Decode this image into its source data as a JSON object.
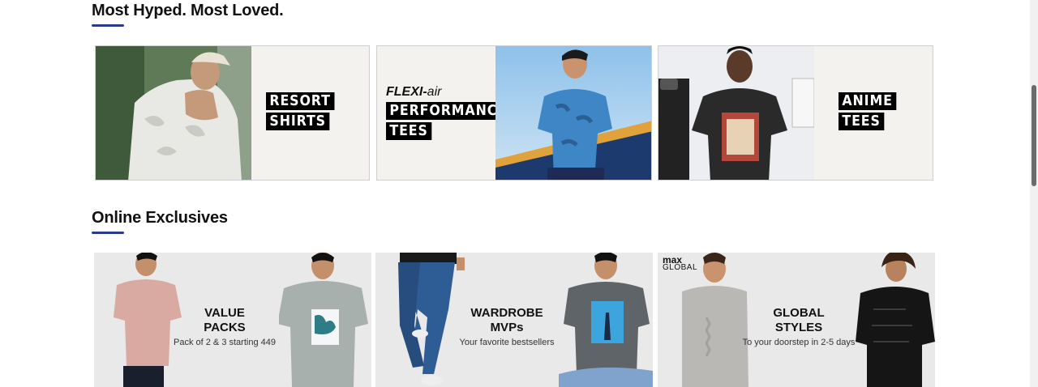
{
  "sections": {
    "hyped": {
      "title": "Most Hyped. Most Loved.",
      "cards": [
        {
          "lines": [
            "RESORT",
            "SHIRTS"
          ]
        },
        {
          "brand_bold": "FLEXI-",
          "brand_light": "air",
          "lines": [
            "PERFORMANCE",
            "TEES"
          ]
        },
        {
          "lines": [
            "ANIME",
            "TEES"
          ]
        }
      ]
    },
    "exclusives": {
      "title": "Online Exclusives",
      "cards": [
        {
          "heading1": "VALUE",
          "heading2": "PACKS",
          "sub": "Pack of 2 & 3 starting 449"
        },
        {
          "heading1": "WARDROBE",
          "heading2": "MVPs",
          "sub": "Your favorite bestsellers"
        },
        {
          "logo_top": "max",
          "logo_bottom": "GLOBAL",
          "heading1": "GLOBAL",
          "heading2": "STYLES",
          "sub": "To your doorstep in 2-5 days"
        }
      ]
    }
  },
  "colors": {
    "accent": "#2a3a8c"
  }
}
